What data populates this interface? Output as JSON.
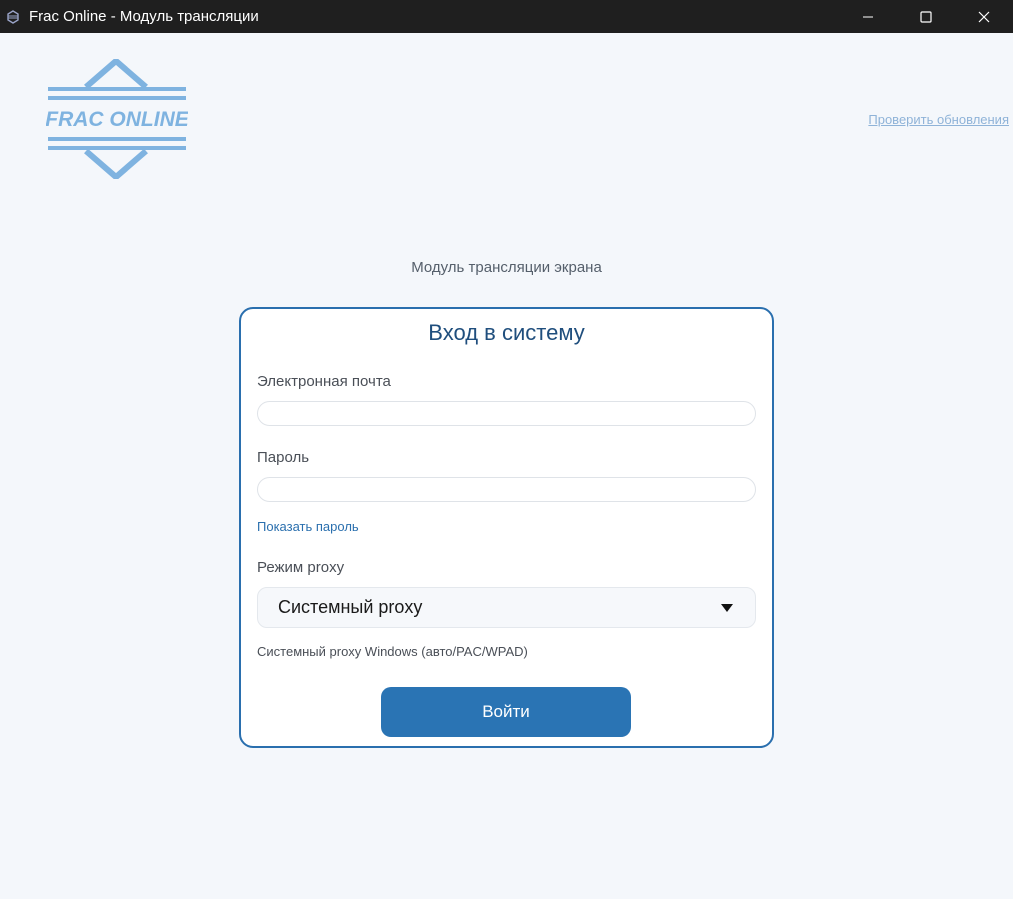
{
  "window": {
    "title": "Frac Online - Модуль трансляции",
    "controls": [
      "minimize",
      "maximize",
      "close"
    ]
  },
  "header": {
    "logo_text": "FRAC ONLINE",
    "update_link": "Проверить обновления"
  },
  "main": {
    "subtitle": "Модуль трансляции экрана"
  },
  "login": {
    "title": "Вход в систему",
    "email_label": "Электронная почта",
    "email_value": "",
    "password_label": "Пароль",
    "password_value": "",
    "show_password": "Показать пароль",
    "proxy_label": "Режим proxy",
    "proxy_selected": "Системный proxy",
    "proxy_description": "Системный proxy Windows (авто/PAC/WPAD)",
    "submit_label": "Войти"
  },
  "colors": {
    "accent": "#2a74b4",
    "card_border": "#2a6fae",
    "logo": "#7fb3e0",
    "titlebar": "#1f1f1f"
  }
}
